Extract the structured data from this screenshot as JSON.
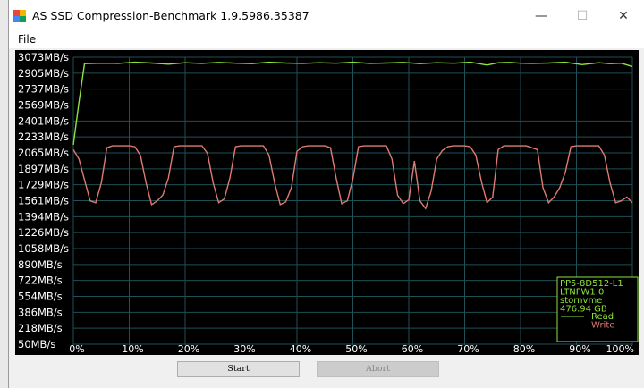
{
  "window": {
    "title": "AS SSD Compression-Benchmark 1.9.5986.35387",
    "minimize_glyph": "—",
    "maximize_glyph": "☐",
    "close_glyph": "✕"
  },
  "menu": {
    "file_label": "File"
  },
  "buttons": {
    "start_label": "Start",
    "abort_label": "Abort"
  },
  "colors": {
    "chart_bg": "#000000",
    "grid": "#1f4f57",
    "read": "#8ee43a",
    "write": "#e07a72",
    "legend_border": "#8ee43a",
    "legend_text": "#8ee43a"
  },
  "chart_data": {
    "type": "line",
    "xlabel": "",
    "ylabel": "",
    "x_ticks": [
      "0%",
      "10%",
      "20%",
      "30%",
      "40%",
      "50%",
      "60%",
      "70%",
      "80%",
      "90%",
      "100%"
    ],
    "y_ticks": [
      "3073MB/s",
      "2905MB/s",
      "2737MB/s",
      "2569MB/s",
      "2401MB/s",
      "2233MB/s",
      "2065MB/s",
      "1897MB/s",
      "1729MB/s",
      "1561MB/s",
      "1394MB/s",
      "1226MB/s",
      "1058MB/s",
      "890MB/s",
      "722MB/s",
      "554MB/s",
      "386MB/s",
      "218MB/s",
      "50MB/s"
    ],
    "ylim": [
      50,
      3073
    ],
    "xlim": [
      0,
      100
    ],
    "grid": true,
    "legend_position": "bottom-right",
    "drive_info": [
      "PP5-8D512-L1",
      "LTNFW1.0",
      "stornvme",
      "476.94 GB"
    ],
    "series": [
      {
        "name": "Read",
        "x": [
          0,
          1,
          2,
          5,
          8,
          11,
          14,
          17,
          20,
          23,
          26,
          29,
          32,
          35,
          38,
          41,
          44,
          47,
          50,
          53,
          56,
          59,
          62,
          65,
          68,
          71,
          74,
          76,
          78,
          80,
          82,
          85,
          88,
          91,
          94,
          96,
          98,
          100
        ],
        "values": [
          2150,
          2600,
          3005,
          3010,
          3008,
          3020,
          3012,
          3000,
          3015,
          3008,
          3018,
          3010,
          3005,
          3020,
          3012,
          3008,
          3015,
          3010,
          3020,
          3008,
          3012,
          3018,
          3005,
          3015,
          3010,
          3020,
          2990,
          3015,
          3018,
          3010,
          3008,
          3012,
          3020,
          2995,
          3015,
          3005,
          3010,
          2975
        ]
      },
      {
        "name": "Write",
        "x": [
          0,
          1,
          2,
          3,
          4,
          5,
          6,
          7,
          8,
          9,
          10,
          11,
          12,
          13,
          14,
          15,
          16,
          17,
          18,
          19,
          20,
          21,
          22,
          23,
          24,
          25,
          26,
          27,
          28,
          29,
          30,
          31,
          32,
          33,
          34,
          35,
          36,
          37,
          38,
          39,
          40,
          41,
          42,
          43,
          44,
          45,
          46,
          47,
          48,
          49,
          50,
          51,
          52,
          53,
          54,
          55,
          56,
          57,
          58,
          59,
          60,
          61,
          62,
          63,
          64,
          65,
          66,
          67,
          68,
          69,
          70,
          71,
          72,
          73,
          74,
          75,
          76,
          77,
          78,
          79,
          80,
          81,
          82,
          83,
          84,
          85,
          86,
          87,
          88,
          89,
          90,
          91,
          92,
          93,
          94,
          95,
          96,
          97,
          98,
          99,
          100
        ],
        "values": [
          2100,
          2000,
          1780,
          1560,
          1540,
          1750,
          2120,
          2140,
          2140,
          2140,
          2140,
          2130,
          2040,
          1750,
          1520,
          1560,
          1620,
          1800,
          2130,
          2140,
          2140,
          2140,
          2140,
          2140,
          2060,
          1750,
          1540,
          1580,
          1800,
          2130,
          2140,
          2140,
          2140,
          2140,
          2140,
          2040,
          1750,
          1520,
          1550,
          1700,
          2080,
          2130,
          2140,
          2140,
          2140,
          2140,
          2120,
          1800,
          1530,
          1560,
          1790,
          2130,
          2140,
          2140,
          2140,
          2140,
          2140,
          2000,
          1620,
          1530,
          1570,
          1980,
          1560,
          1480,
          1660,
          2000,
          2090,
          2130,
          2140,
          2140,
          2140,
          2130,
          2040,
          1760,
          1540,
          1600,
          2100,
          2140,
          2140,
          2140,
          2140,
          2140,
          2120,
          2100,
          1700,
          1540,
          1600,
          1700,
          1860,
          2130,
          2140,
          2140,
          2140,
          2140,
          2140,
          2040,
          1750,
          1540,
          1560,
          1600,
          1540
        ]
      }
    ]
  }
}
